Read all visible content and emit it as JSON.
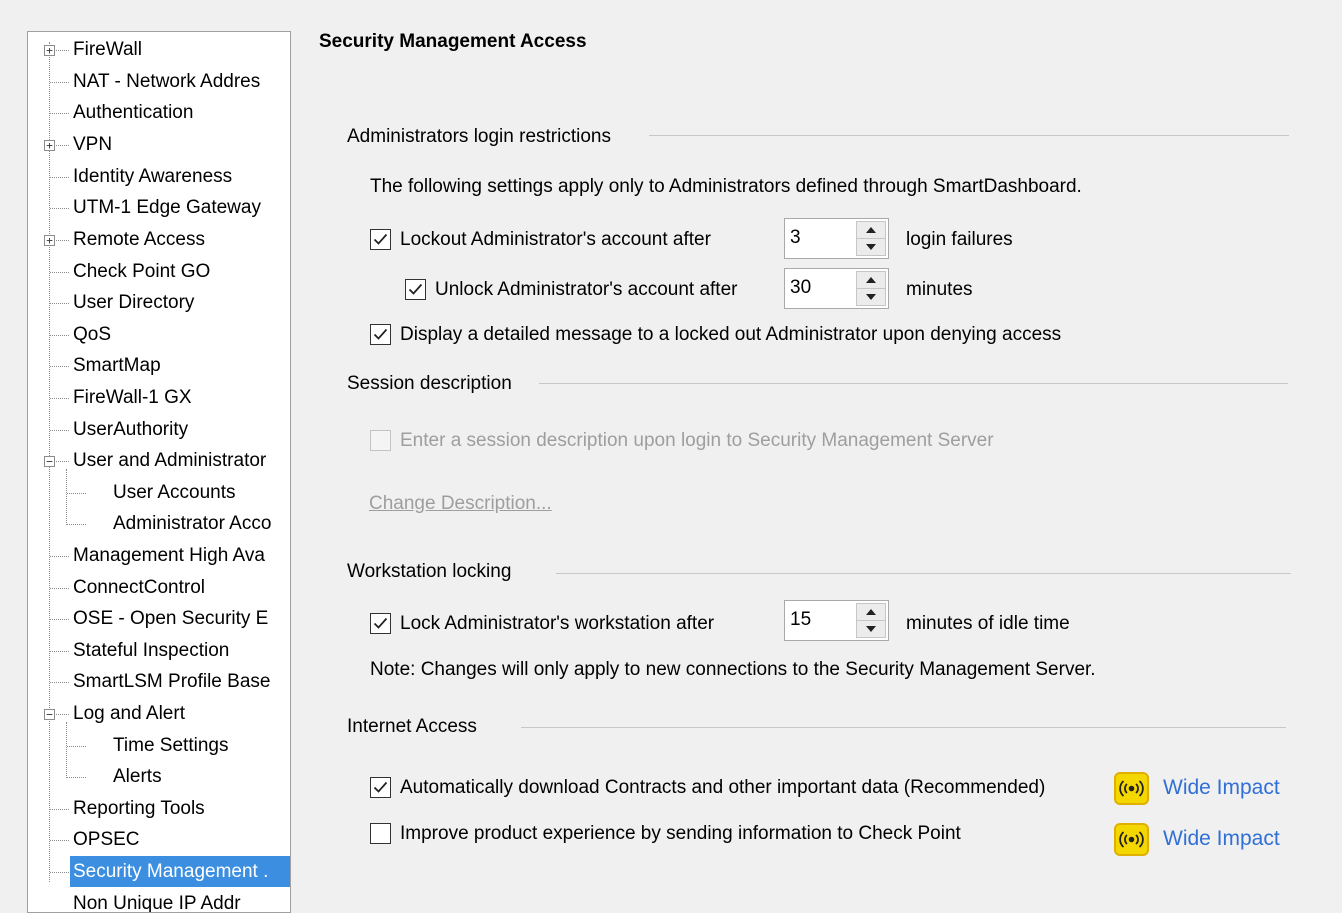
{
  "tree": {
    "items": [
      {
        "label": "FireWall"
      },
      {
        "label": "NAT - Network Addres"
      },
      {
        "label": "Authentication"
      },
      {
        "label": "VPN"
      },
      {
        "label": "Identity Awareness"
      },
      {
        "label": "UTM-1 Edge Gateway"
      },
      {
        "label": "Remote Access"
      },
      {
        "label": "Check Point GO"
      },
      {
        "label": "User Directory"
      },
      {
        "label": "QoS"
      },
      {
        "label": "SmartMap"
      },
      {
        "label": "FireWall-1 GX"
      },
      {
        "label": "UserAuthority"
      },
      {
        "label": "User and Administrator"
      },
      {
        "label": "User Accounts"
      },
      {
        "label": "Administrator Acco"
      },
      {
        "label": "Management High Ava"
      },
      {
        "label": "ConnectControl"
      },
      {
        "label": "OSE - Open Security E"
      },
      {
        "label": "Stateful Inspection"
      },
      {
        "label": "SmartLSM Profile Base"
      },
      {
        "label": "Log and Alert"
      },
      {
        "label": "Time Settings"
      },
      {
        "label": "Alerts"
      },
      {
        "label": "Reporting Tools"
      },
      {
        "label": "OPSEC"
      },
      {
        "label": "Security Management ."
      },
      {
        "label": "Non Unique IP Addr"
      }
    ],
    "selected_color": "#3b8ee0"
  },
  "page": {
    "title": "Security Management Access"
  },
  "admin_login": {
    "group_label": "Administrators login restrictions",
    "note": "The following settings apply only to Administrators defined through SmartDashboard.",
    "lockout_label": "Lockout Administrator's account after",
    "lockout_checked": true,
    "lockout_value": "3",
    "lockout_suffix": "login failures",
    "unlock_label": "Unlock Administrator's account after",
    "unlock_checked": true,
    "unlock_value": "30",
    "unlock_suffix": "minutes",
    "display_msg_label": "Display a detailed message to a locked out Administrator upon denying access",
    "display_msg_checked": true
  },
  "session": {
    "group_label": "Session description",
    "enter_label": "Enter a session description upon login to Security Management Server",
    "enter_checked": false,
    "change_link": "Change Description..."
  },
  "workstation": {
    "group_label": "Workstation locking",
    "lock_label": "Lock Administrator's workstation after",
    "lock_checked": true,
    "lock_value": "15",
    "lock_suffix": "minutes of idle time",
    "note": "Note: Changes will only apply to new connections to the Security Management Server."
  },
  "internet": {
    "group_label": "Internet Access",
    "auto_label": "Automatically download Contracts and other important data (Recommended)",
    "auto_checked": true,
    "improve_label": "Improve product experience by sending information to Check Point",
    "improve_checked": false,
    "impact_label": "Wide Impact",
    "impact_color": "#f5d700",
    "impact_icon": "broadcast-icon"
  }
}
